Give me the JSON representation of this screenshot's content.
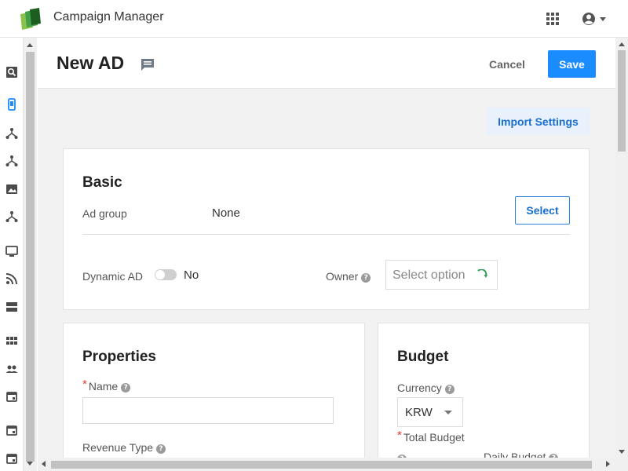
{
  "app": {
    "title": "Campaign Manager",
    "logo_icon": "stacked-cards-logo",
    "apps_icon": "apps-grid-icon",
    "user_icon": "user-account-icon"
  },
  "sidebar": {
    "items": [
      {
        "icon": "search-report-icon",
        "active": false
      },
      {
        "icon": "mobile-device-icon",
        "active": true
      },
      {
        "icon": "network-icon",
        "active": false
      },
      {
        "icon": "network-icon",
        "active": false
      },
      {
        "icon": "image-icon",
        "active": false
      },
      {
        "icon": "network-icon",
        "active": false
      },
      {
        "icon": "monitor-icon",
        "active": false
      },
      {
        "icon": "rss-feed-icon",
        "active": false
      },
      {
        "icon": "storage-icon",
        "active": false
      },
      {
        "icon": "grid-view-icon",
        "active": false
      },
      {
        "icon": "people-icon",
        "active": false
      },
      {
        "icon": "calendar-icon",
        "active": false
      },
      {
        "icon": "calendar-icon",
        "active": false
      },
      {
        "icon": "calendar-icon",
        "active": false
      }
    ]
  },
  "header": {
    "title": "New AD",
    "cancel_label": "Cancel",
    "save_label": "Save"
  },
  "actions": {
    "import_label": "Import Settings"
  },
  "basic": {
    "title": "Basic",
    "ad_group_label": "Ad group",
    "ad_group_value": "None",
    "select_label": "Select",
    "dynamic_ad_label": "Dynamic AD",
    "dynamic_ad_value": "No",
    "owner_label": "Owner",
    "owner_placeholder": "Select option"
  },
  "properties": {
    "title": "Properties",
    "name_label": "Name",
    "name_value": "",
    "revenue_type_label": "Revenue Type"
  },
  "budget": {
    "title": "Budget",
    "currency_label": "Currency",
    "currency_value": "KRW",
    "total_budget_label": "Total Budget",
    "daily_budget_label": "Daily Budget"
  },
  "colors": {
    "primary": "#1a8cff",
    "required": "#e53935",
    "sidebar_active": "#1a8cff",
    "sidebar_icon": "#4a4a4a"
  }
}
